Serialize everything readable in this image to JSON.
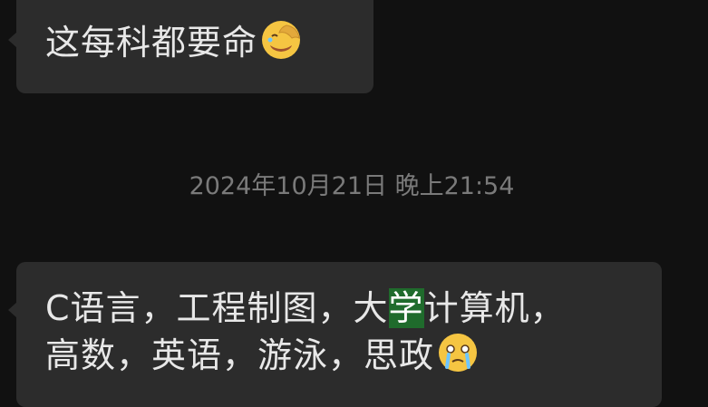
{
  "messages": [
    {
      "text": "这每科都要命",
      "emoji": "face-palm-emoji"
    },
    {
      "line1_before": "C语言，工程制图，大",
      "line1_highlight": "学",
      "line1_after": "计算机，",
      "line2": "高数，英语，游泳，思政",
      "emoji": "crying-face-emoji"
    }
  ],
  "timestamp": "2024年10月21日 晚上21:54",
  "colors": {
    "background": "#111111",
    "bubble": "#2c2c2c",
    "text": "#e8e8e8",
    "timestamp": "#7a7a7a",
    "highlight": "#1f6b2c"
  }
}
